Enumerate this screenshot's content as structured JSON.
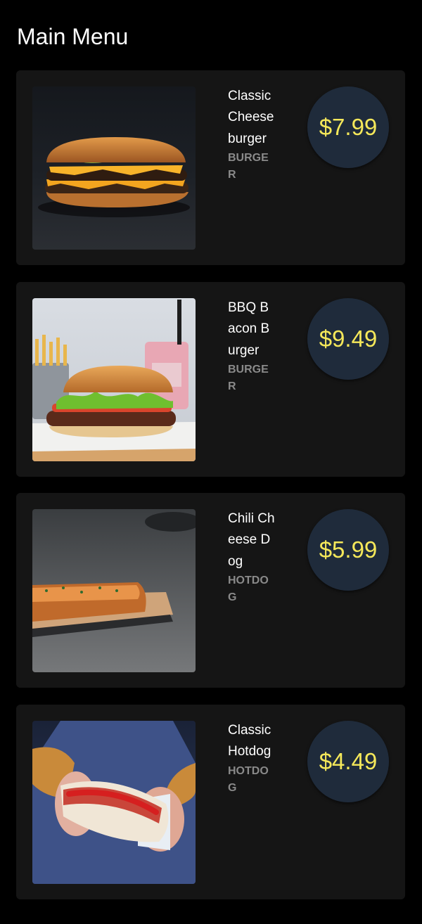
{
  "page": {
    "title": "Main Menu"
  },
  "colors": {
    "background": "#000000",
    "card": "#151515",
    "price_badge": "#1f2b3b",
    "price_text": "#f5e85a",
    "category_text": "#8a8a8a"
  },
  "items": [
    {
      "name": "Classic Cheeseburger",
      "category": "BURGER",
      "price": "$7.99",
      "image_icon": "cheeseburger-photo"
    },
    {
      "name": "BBQ Bacon Burger",
      "category": "BURGER",
      "price": "$9.49",
      "image_icon": "bbq-bacon-burger-photo"
    },
    {
      "name": "Chili Cheese Dog",
      "category": "HOTDOG",
      "price": "$5.99",
      "image_icon": "chili-cheese-dog-photo"
    },
    {
      "name": "Classic Hotdog",
      "category": "HOTDOG",
      "price": "$4.49",
      "image_icon": "classic-hotdog-photo"
    }
  ]
}
